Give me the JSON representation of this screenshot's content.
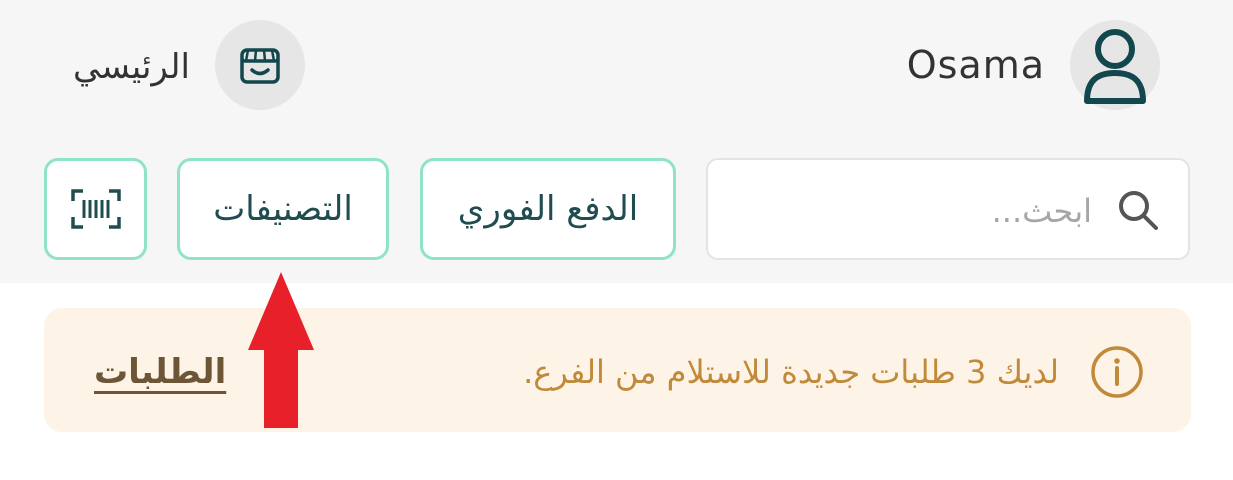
{
  "header": {
    "user_name": "Osama",
    "avatar_icon": "user-icon",
    "home_label": "الرئيسي",
    "home_icon": "store-icon"
  },
  "toolbar": {
    "search_placeholder": "ابحث...",
    "search_icon": "search-icon",
    "instant_pay_label": "الدفع الفوري",
    "categories_label": "التصنيفات",
    "scan_icon": "barcode-scan-icon"
  },
  "notice": {
    "icon": "info-icon",
    "text": "لديك 3 طلبات جديدة للاستلام من الفرع.",
    "link_label": "الطلبات"
  },
  "annotation": {
    "arrow_icon": "red-up-arrow-icon",
    "arrow_color": "#e8202a"
  },
  "colors": {
    "accent_border": "#8fe3c6",
    "primary_text": "#1f4d50",
    "notice_bg": "#fdf3e6",
    "notice_text": "#c18a3a"
  }
}
